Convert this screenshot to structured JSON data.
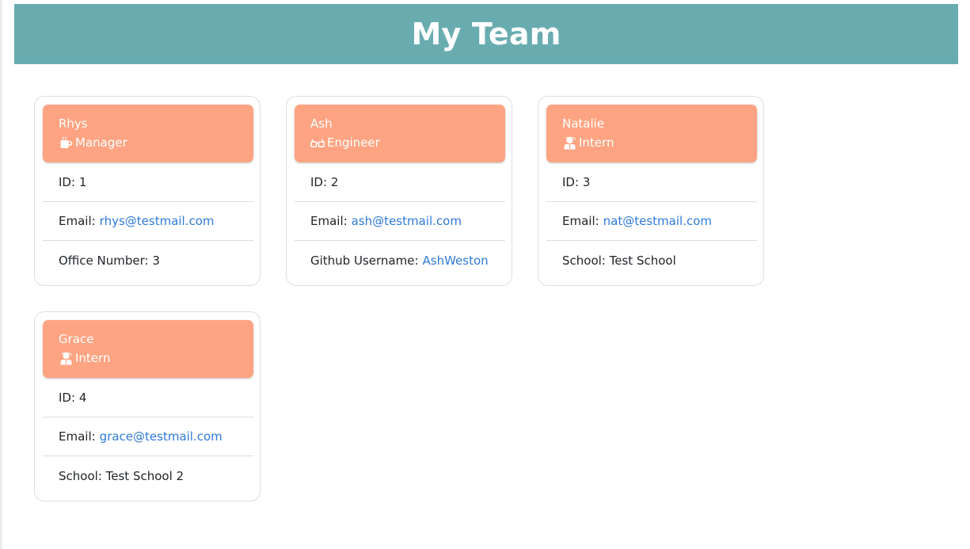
{
  "page": {
    "title": "My Team"
  },
  "colors": {
    "jumbotron": "#69acb0",
    "card_header": "#ffa482",
    "link": "#2f7ad8"
  },
  "cards": [
    {
      "name": "Rhys",
      "role": "Manager",
      "role_icon": "mug-icon",
      "id_label": "ID:",
      "id": "1",
      "email_label": "Email:",
      "email": "rhys@testmail.com",
      "extra_label": "Office Number:",
      "extra_value": "3"
    },
    {
      "name": "Ash",
      "role": "Engineer",
      "role_icon": "glasses-icon",
      "id_label": "ID:",
      "id": "2",
      "email_label": "Email:",
      "email": "ash@testmail.com",
      "extra_label": "Github Username:",
      "extra_value": "AshWeston"
    },
    {
      "name": "Natalie",
      "role": "Intern",
      "role_icon": "graduate-icon",
      "id_label": "ID:",
      "id": "3",
      "email_label": "Email:",
      "email": "nat@testmail.com",
      "extra_label": "School:",
      "extra_value": "Test School"
    },
    {
      "name": "Grace",
      "role": "Intern",
      "role_icon": "graduate-icon",
      "id_label": "ID:",
      "id": "4",
      "email_label": "Email:",
      "email": "grace@testmail.com",
      "extra_label": "School:",
      "extra_value": "Test School 2"
    }
  ]
}
